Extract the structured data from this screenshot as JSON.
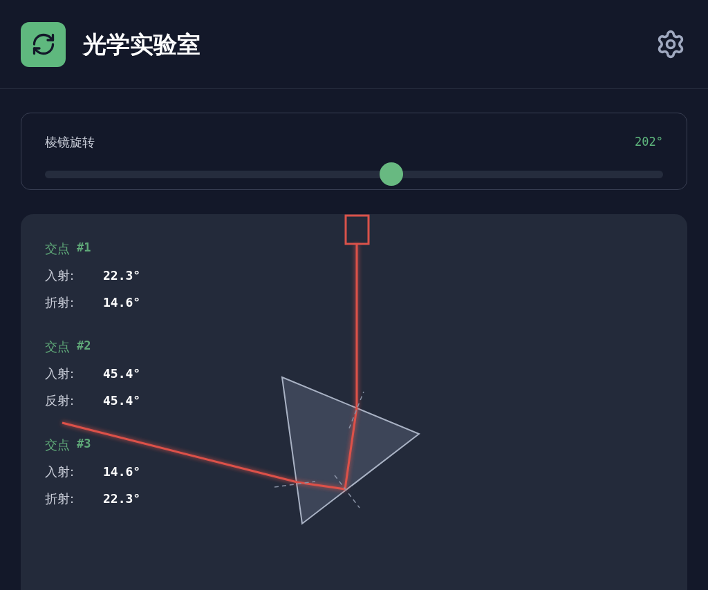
{
  "header": {
    "title": "光学实验室"
  },
  "control": {
    "label": "棱镜旋转",
    "reading": "202°",
    "level": 0.56
  },
  "intersections": [
    {
      "title": "交点",
      "number": "#1",
      "rows": [
        {
          "label": "入射:",
          "value": "22.3°"
        },
        {
          "label": "折射:",
          "value": "14.6°"
        }
      ]
    },
    {
      "title": "交点",
      "number": "#2",
      "rows": [
        {
          "label": "入射:",
          "value": "45.4°"
        },
        {
          "label": "反射:",
          "value": "45.4°"
        }
      ]
    },
    {
      "title": "交点",
      "number": "#3",
      "rows": [
        {
          "label": "入射:",
          "value": "14.6°"
        },
        {
          "label": "折射:",
          "value": "22.3°"
        }
      ]
    }
  ]
}
